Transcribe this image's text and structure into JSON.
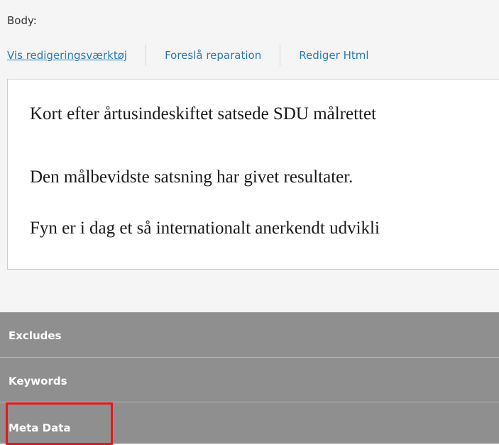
{
  "body_label": "Body:",
  "toolbar": {
    "show_editor_tools": "Vis redigeringsværktøj",
    "suggest_repair": "Foreslå reparation",
    "edit_html": "Rediger Html"
  },
  "editor": {
    "paragraphs": [
      "Kort efter årtusindeskiftet satsede SDU målrettet",
      "Den målbevidste satsning har givet resultater.",
      "Fyn er i dag et så internationalt anerkendt udvikli"
    ]
  },
  "accordion": {
    "items": [
      {
        "label": "Excludes"
      },
      {
        "label": "Keywords"
      },
      {
        "label": "Meta Data"
      }
    ]
  },
  "colors": {
    "link": "#2a7ab3",
    "accordion_bg": "#8f8f8f",
    "highlight": "#e8161a"
  }
}
